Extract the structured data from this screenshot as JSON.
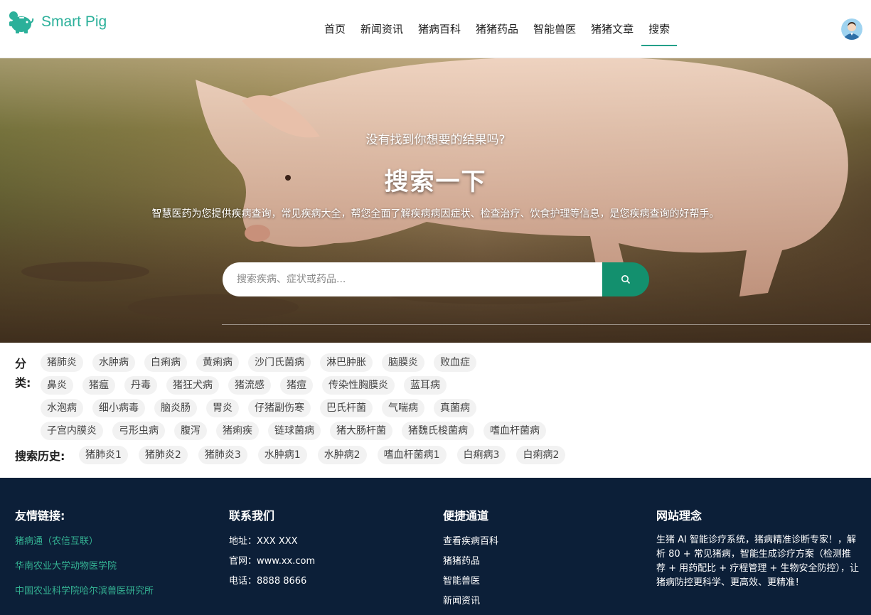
{
  "brand": {
    "name": "Smart Pig",
    "color": "#2bb09a"
  },
  "nav": {
    "items": [
      "首页",
      "新闻资讯",
      "猪病百科",
      "猪猪药品",
      "智能兽医",
      "猪猪文章",
      "搜索"
    ],
    "active_index": 6
  },
  "hero": {
    "subtitle": "没有找到你想要的结果吗?",
    "title": "搜索一下",
    "description": "智慧医药为您提供疾病查询，常见疾病大全，帮您全面了解疾病病因症状、检查治疗、饮食护理等信息，是您疾病查询的好帮手。",
    "search_placeholder": "搜索疾病、症状或药品...",
    "search_icon": "search-icon",
    "accent": "#13906e"
  },
  "categories": {
    "label": "分类:",
    "rows": [
      [
        "猪肺炎",
        "水肿病",
        "白痢病",
        "黄痢病",
        "沙门氏菌病",
        "淋巴肿胀",
        "脑膜炎",
        "败血症"
      ],
      [
        "鼻炎",
        "猪瘟",
        "丹毒",
        "猪狂犬病",
        "猪流感",
        "猪痘",
        "传染性胸膜炎",
        "蓝耳病"
      ],
      [
        "水泡病",
        "细小病毒",
        "脑炎肠",
        "胃炎",
        "仔猪副伤寒",
        "巴氏杆菌",
        "气喘病",
        "真菌病"
      ],
      [
        "子宫内膜炎",
        "弓形虫病",
        "腹泻",
        "猪痢疾",
        "链球菌病",
        "猪大肠杆菌",
        "猪魏氏梭菌病",
        "嗜血杆菌病"
      ]
    ]
  },
  "history": {
    "label": "搜索历史:",
    "items": [
      "猪肺炎1",
      "猪肺炎2",
      "猪肺炎3",
      "水肿病1",
      "水肿病2",
      "嗜血杆菌病1",
      "白痢病3",
      "白痢病2"
    ]
  },
  "footer": {
    "background": "#0c1f38",
    "friends": {
      "title": "友情链接:",
      "links": [
        "猪病通（农信互联）",
        "华南农业大学动物医学院",
        "中国农业科学院哈尔滨兽医研究所"
      ]
    },
    "contact": {
      "title": "联系我们",
      "lines": [
        "地址：XXX XXX",
        "官网：www.xx.com",
        "电话：8888 8666"
      ]
    },
    "quick": {
      "title": "便捷通道",
      "links": [
        "查看疾病百科",
        "猪猪药品",
        "智能兽医",
        "新闻资讯"
      ]
    },
    "philosophy": {
      "title": "网站理念",
      "text": "生猪 AI 智能诊疗系统，猪病精准诊断专家！，解析 80 + 常见猪病，智能生成诊疗方案（检测推荐 + 用药配比 + 疗程管理 + 生物安全防控），让猪病防控更科学、更高效、更精准！"
    }
  }
}
